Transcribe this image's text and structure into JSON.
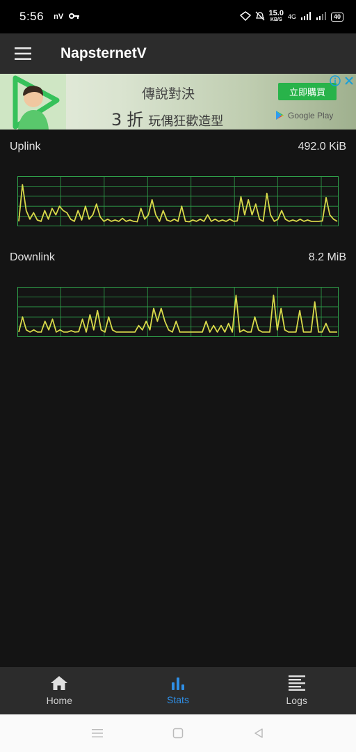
{
  "status_bar": {
    "time": "5:56",
    "left_icons": [
      "nv-icon",
      "key-icon"
    ],
    "nv_text": "nV",
    "net_speed_value": "15.0",
    "net_speed_unit": "KB/S",
    "network_type": "4G",
    "battery": "40"
  },
  "app_bar": {
    "title": "NapsternetV",
    "menu_icon": "hamburger-menu-icon"
  },
  "ad": {
    "headline": "傳說對決",
    "sub_number": "3",
    "sub_big": "折",
    "sub_small": "玩偶狂歡造型",
    "cta_label": "立即購買",
    "store_label": "Google Play"
  },
  "stats": {
    "uplink": {
      "label": "Uplink",
      "value": "492.0 KiB"
    },
    "downlink": {
      "label": "Downlink",
      "value": "8.2 MiB"
    }
  },
  "graph_colors": {
    "line": "#d8d84a",
    "grid": "#2fa04a",
    "border": "#2fa04a"
  },
  "uplink_graph": [
    0.05,
    0.9,
    0.3,
    0.1,
    0.25,
    0.08,
    0.05,
    0.3,
    0.1,
    0.35,
    0.2,
    0.4,
    0.3,
    0.25,
    0.1,
    0.05,
    0.3,
    0.08,
    0.4,
    0.1,
    0.2,
    0.45,
    0.15,
    0.05,
    0.1,
    0.05,
    0.08,
    0.05,
    0.12,
    0.05,
    0.08,
    0.05,
    0.04,
    0.35,
    0.1,
    0.2,
    0.55,
    0.2,
    0.05,
    0.3,
    0.08,
    0.05,
    0.1,
    0.05,
    0.4,
    0.05,
    0.04,
    0.08,
    0.05,
    0.1,
    0.05,
    0.2,
    0.05,
    0.1,
    0.05,
    0.08,
    0.05,
    0.1,
    0.05,
    0.06,
    0.62,
    0.2,
    0.55,
    0.2,
    0.45,
    0.1,
    0.05,
    0.7,
    0.2,
    0.05,
    0.1,
    0.3,
    0.1,
    0.05,
    0.08,
    0.05,
    0.1,
    0.05,
    0.08,
    0.05,
    0.05,
    0.05,
    0.06,
    0.6,
    0.2,
    0.1,
    0.05
  ],
  "downlink_graph": [
    0.05,
    0.4,
    0.1,
    0.05,
    0.1,
    0.05,
    0.05,
    0.3,
    0.1,
    0.35,
    0.05,
    0.1,
    0.05,
    0.05,
    0.08,
    0.05,
    0.06,
    0.35,
    0.05,
    0.45,
    0.1,
    0.55,
    0.1,
    0.05,
    0.4,
    0.1,
    0.05,
    0.05,
    0.05,
    0.05,
    0.05,
    0.05,
    0.2,
    0.1,
    0.3,
    0.1,
    0.6,
    0.3,
    0.6,
    0.3,
    0.1,
    0.05,
    0.3,
    0.05,
    0.05,
    0.05,
    0.05,
    0.05,
    0.05,
    0.05,
    0.3,
    0.05,
    0.2,
    0.05,
    0.2,
    0.05,
    0.25,
    0.05,
    0.9,
    0.05,
    0.1,
    0.05,
    0.05,
    0.4,
    0.1,
    0.05,
    0.05,
    0.05,
    0.9,
    0.1,
    0.6,
    0.1,
    0.05,
    0.05,
    0.05,
    0.55,
    0.05,
    0.05,
    0.05,
    0.75,
    0.05,
    0.05,
    0.25,
    0.05,
    0.05,
    0.05
  ],
  "bottom_nav": {
    "items": [
      {
        "label": "Home",
        "icon": "home-icon",
        "active": false
      },
      {
        "label": "Stats",
        "icon": "bar-chart-icon",
        "active": true
      },
      {
        "label": "Logs",
        "icon": "list-icon",
        "active": false
      }
    ]
  },
  "system_nav": {
    "icons": [
      "recents-icon",
      "home-square-icon",
      "back-triangle-icon"
    ]
  }
}
